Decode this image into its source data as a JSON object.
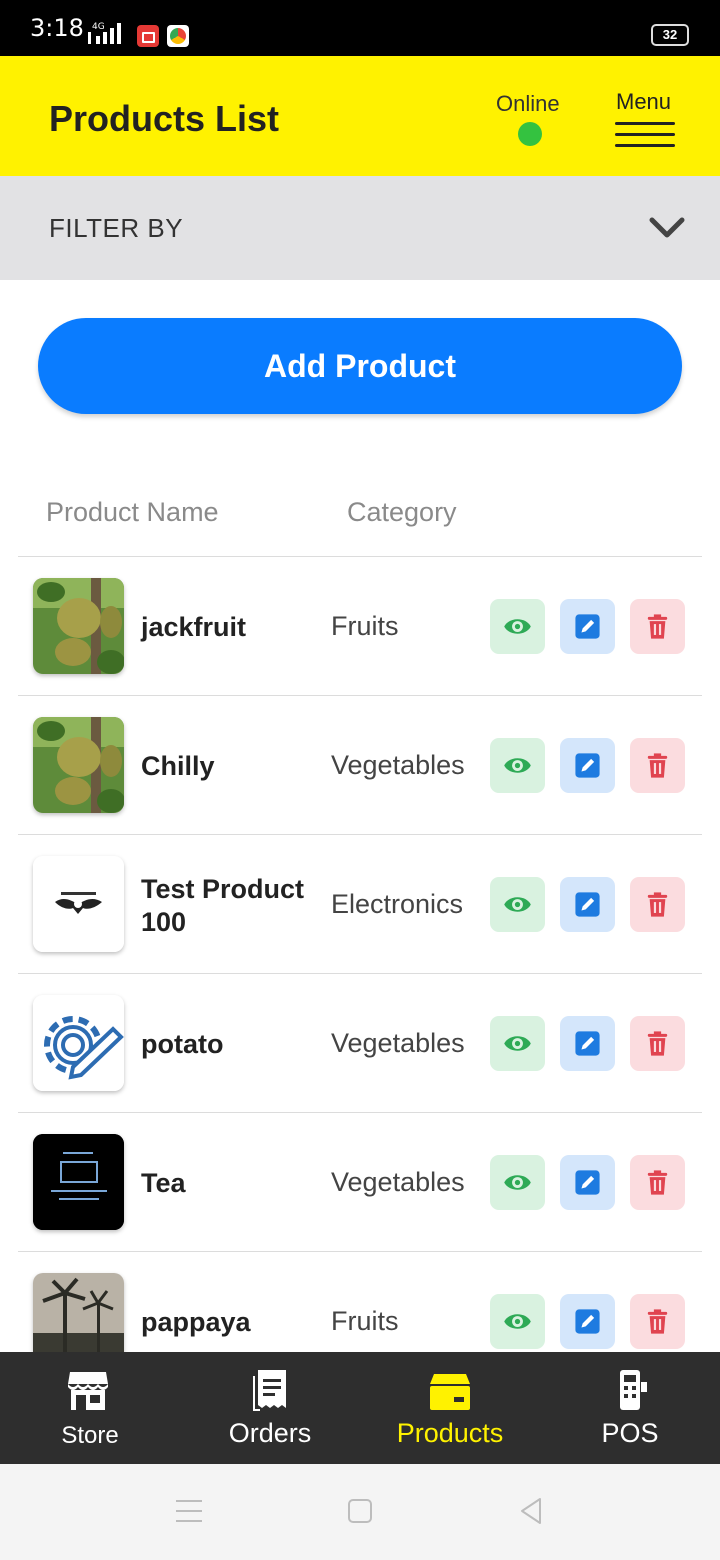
{
  "status_bar": {
    "time": "3:18",
    "network": "4G",
    "battery": "32"
  },
  "header": {
    "title": "Products List",
    "online_label": "Online",
    "menu_label": "Menu"
  },
  "filter": {
    "label": "FILTER BY"
  },
  "add_button": {
    "label": "Add Product"
  },
  "table": {
    "columns": [
      "Product Name",
      "Category"
    ],
    "rows": [
      {
        "name": "jackfruit",
        "category": "Fruits",
        "image": "jackfruit-photo"
      },
      {
        "name": "Chilly",
        "category": "Vegetables",
        "image": "jackfruit-photo"
      },
      {
        "name": "Test Product 100",
        "category": "Electronics",
        "image": "winged-logo"
      },
      {
        "name": "potato",
        "category": "Vegetables",
        "image": "gear-pencil-logo"
      },
      {
        "name": "Tea",
        "category": "Vegetables",
        "image": "life-is-strange-logo"
      },
      {
        "name": "pappaya",
        "category": "Fruits",
        "image": "palm-trees-photo"
      }
    ]
  },
  "bottom_nav": {
    "items": [
      {
        "label": "Store",
        "icon": "store-icon"
      },
      {
        "label": "Orders",
        "icon": "receipt-icon"
      },
      {
        "label": "Products",
        "icon": "box-icon",
        "active": true
      },
      {
        "label": "POS",
        "icon": "pos-terminal-icon"
      }
    ]
  },
  "colors": {
    "header": "#fff200",
    "primary": "#0a7cff",
    "online": "#34c240",
    "nav_bg": "#2e2e2e",
    "nav_active": "#fff200"
  }
}
